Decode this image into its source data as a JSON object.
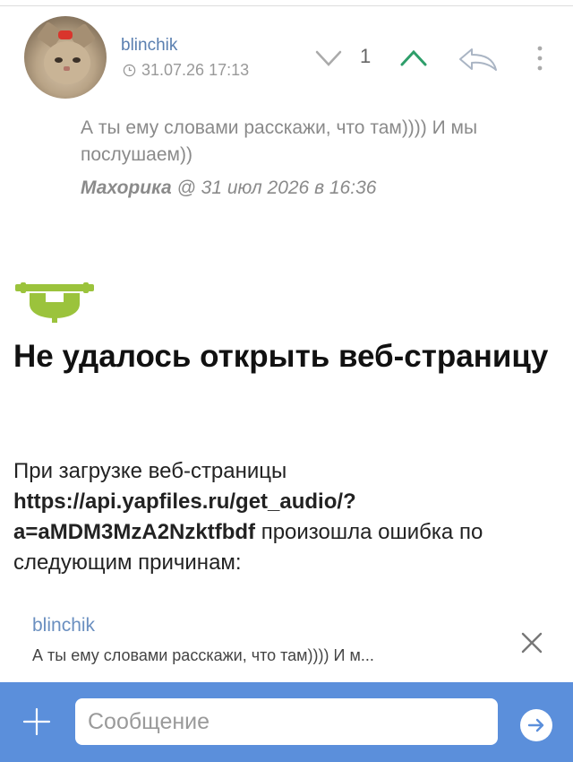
{
  "post": {
    "author": "blinchik",
    "date": "31.07.26 17:13",
    "score": "1",
    "quote_text": "А ты ему словами расскажи, что там)))) И мы послушаем))",
    "quote_nick": "Махорика",
    "quote_rest": " @ 31 июл 2026 в 16:36"
  },
  "webview_error": {
    "title": "Не удалось открыть веб-страницу",
    "intro": "При загрузке веб-страницы ",
    "url": "https://api.yapfiles.ru/get_audio/?a=aMDM3MzA2Nzktfbdf",
    "tail": " произошла ошибка по следующим причинам:"
  },
  "reply_preview": {
    "author": "blinchik",
    "text": "А ты ему словами расскажи, что там))))  И м..."
  },
  "composer": {
    "placeholder": "Сообщение"
  },
  "colors": {
    "accent": "#5b8fdb",
    "vote_up": "#2e9e6a",
    "android": "#9bc33c"
  },
  "icons": [
    "clock-icon",
    "chevron-down-icon",
    "chevron-up-icon",
    "reply-icon",
    "more-icon",
    "android-icon",
    "close-icon",
    "plus-icon",
    "send-icon"
  ]
}
